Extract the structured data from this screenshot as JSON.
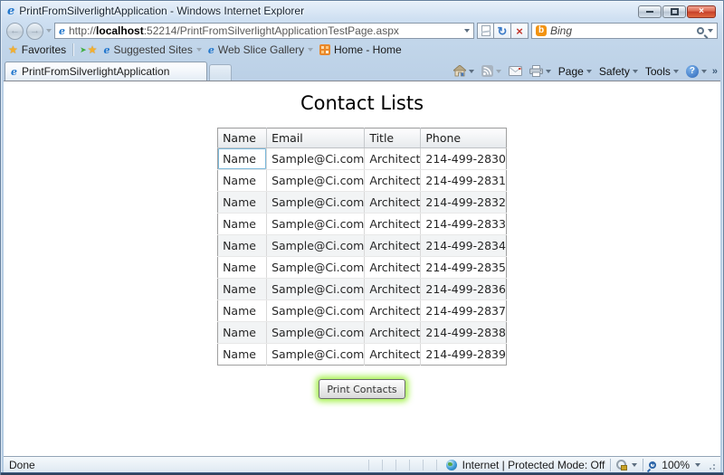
{
  "window": {
    "title": "PrintFromSilverlightApplication - Windows Internet Explorer"
  },
  "address_bar": {
    "protocol": "http://",
    "domain": "localhost",
    "path": ":52214/PrintFromSilverlightApplicationTestPage.aspx"
  },
  "search_box": {
    "placeholder": "Bing"
  },
  "favorites_bar": {
    "favorites_button": "Favorites",
    "suggested_sites": "Suggested Sites",
    "web_slice_gallery": "Web Slice Gallery",
    "home_feed": "Home - Home"
  },
  "tab_bar": {
    "active_tab": "PrintFromSilverlightApplication"
  },
  "command_bar": {
    "page": "Page",
    "safety": "Safety",
    "tools": "Tools"
  },
  "content": {
    "heading": "Contact Lists",
    "print_button": "Print Contacts",
    "table": {
      "columns": [
        "Name",
        "Email",
        "Title",
        "Phone"
      ],
      "rows": [
        {
          "name": "Name",
          "email": "Sample@Ci.com",
          "title": "Architect",
          "phone": "214-499-2830"
        },
        {
          "name": "Name",
          "email": "Sample@Ci.com",
          "title": "Architect",
          "phone": "214-499-2831"
        },
        {
          "name": "Name",
          "email": "Sample@Ci.com",
          "title": "Architect",
          "phone": "214-499-2832"
        },
        {
          "name": "Name",
          "email": "Sample@Ci.com",
          "title": "Architect",
          "phone": "214-499-2833"
        },
        {
          "name": "Name",
          "email": "Sample@Ci.com",
          "title": "Architect",
          "phone": "214-499-2834"
        },
        {
          "name": "Name",
          "email": "Sample@Ci.com",
          "title": "Architect",
          "phone": "214-499-2835"
        },
        {
          "name": "Name",
          "email": "Sample@Ci.com",
          "title": "Architect",
          "phone": "214-499-2836"
        },
        {
          "name": "Name",
          "email": "Sample@Ci.com",
          "title": "Architect",
          "phone": "214-499-2837"
        },
        {
          "name": "Name",
          "email": "Sample@Ci.com",
          "title": "Architect",
          "phone": "214-499-2838"
        },
        {
          "name": "Name",
          "email": "Sample@Ci.com",
          "title": "Architect",
          "phone": "214-499-2839"
        }
      ]
    }
  },
  "status_bar": {
    "status": "Done",
    "zone": "Internet | Protected Mode: Off",
    "zoom": "100%"
  },
  "icons": {
    "ie_logo": "e",
    "star": "★",
    "add_arrow": "➤",
    "back": "←",
    "forward": "→",
    "refresh": "↻",
    "stop": "×",
    "close": "×",
    "help": "?",
    "bing": "b",
    "overflow": "»"
  },
  "colors": {
    "glow_green": "#8cee1e",
    "close_red": "#c6402a",
    "bing_orange": "#f29311",
    "titlebar_blue": "#c2d6ea"
  }
}
